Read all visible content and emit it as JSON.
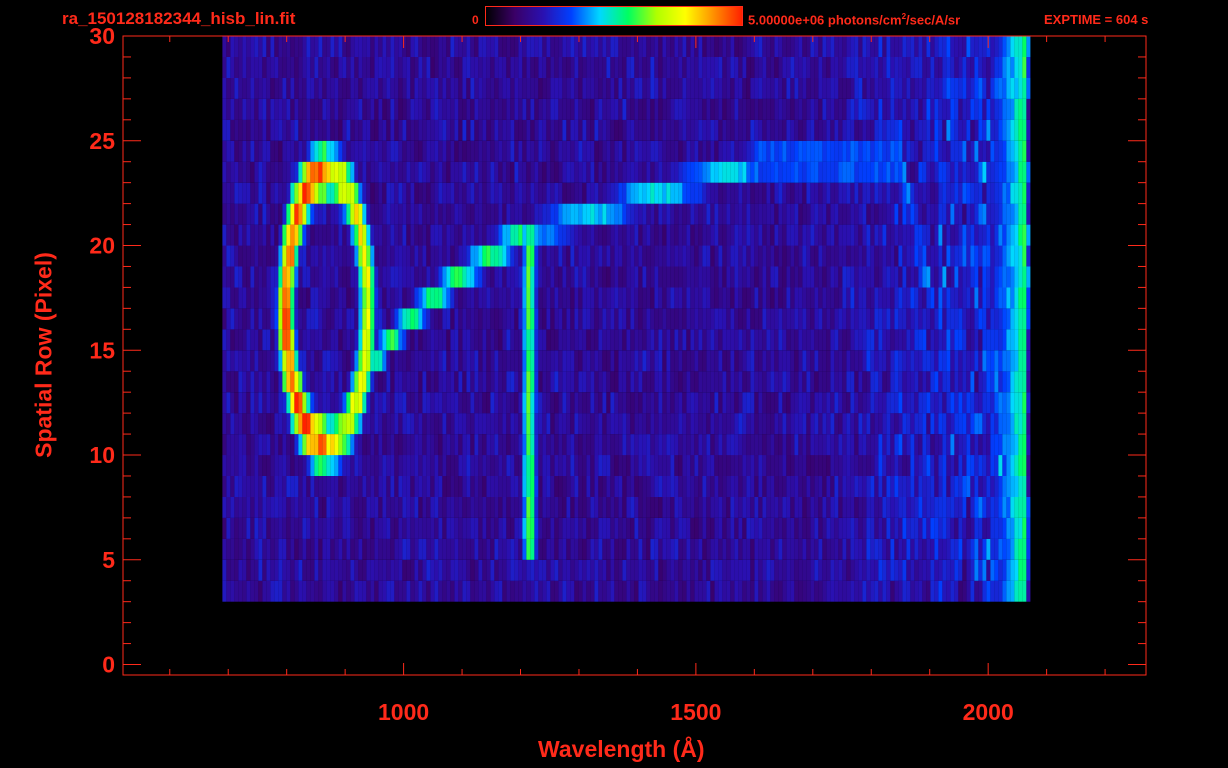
{
  "header": {
    "filename": "ra_150128182344_hisb_lin.fit",
    "colorbar_min": "0",
    "colorbar_max_prefix": "5.00000e+06 photons/cm",
    "colorbar_max_exp": "2",
    "colorbar_max_suffix": "/sec/A/sr",
    "exptime": "EXPTIME = 604 s"
  },
  "colors": {
    "axis": "#ff2a1a",
    "background": "#000000",
    "colormap": [
      "#000000",
      "#3a0066",
      "#2a10b0",
      "#0040ff",
      "#00d8ff",
      "#00ff60",
      "#b0ff00",
      "#ffff00",
      "#ff9000",
      "#ff2000"
    ]
  },
  "chart_data": {
    "type": "heatmap",
    "title": "ra_150128182344_hisb_lin.fit",
    "xlabel": "Wavelength (Å)",
    "ylabel": "Spatial Row (Pixel)",
    "xlim": [
      520,
      2270
    ],
    "ylim": [
      -0.5,
      30
    ],
    "x_ticks": [
      1000,
      1500,
      2000
    ],
    "y_ticks": [
      0,
      5,
      10,
      15,
      20,
      25,
      30
    ],
    "colorbar": {
      "min": 0,
      "max": 5000000,
      "units": "photons/cm^2/sec/A/sr"
    },
    "data_extent": {
      "x": [
        690,
        2070
      ],
      "rows": [
        3,
        30
      ]
    },
    "features": [
      {
        "name": "ring",
        "center_x": 865,
        "center_row": 17,
        "x_halfwidth": 70,
        "row_halfwidth": 6.5,
        "peak": 0.95
      },
      {
        "name": "diagonal-arc",
        "from": [
          900,
          10.5
        ],
        "to": [
          1200,
          20.5
        ],
        "peak": 0.55
      },
      {
        "name": "vertical-line",
        "x": 1212,
        "rows": [
          5,
          21
        ],
        "peak": 0.58
      },
      {
        "name": "upper-band",
        "from_x": 1200,
        "to_x": 1850,
        "rows": [
          20.5,
          24
        ],
        "peak": 0.45
      },
      {
        "name": "red-edge",
        "x_range": [
          1950,
          2060
        ],
        "peak": 0.55
      }
    ]
  }
}
